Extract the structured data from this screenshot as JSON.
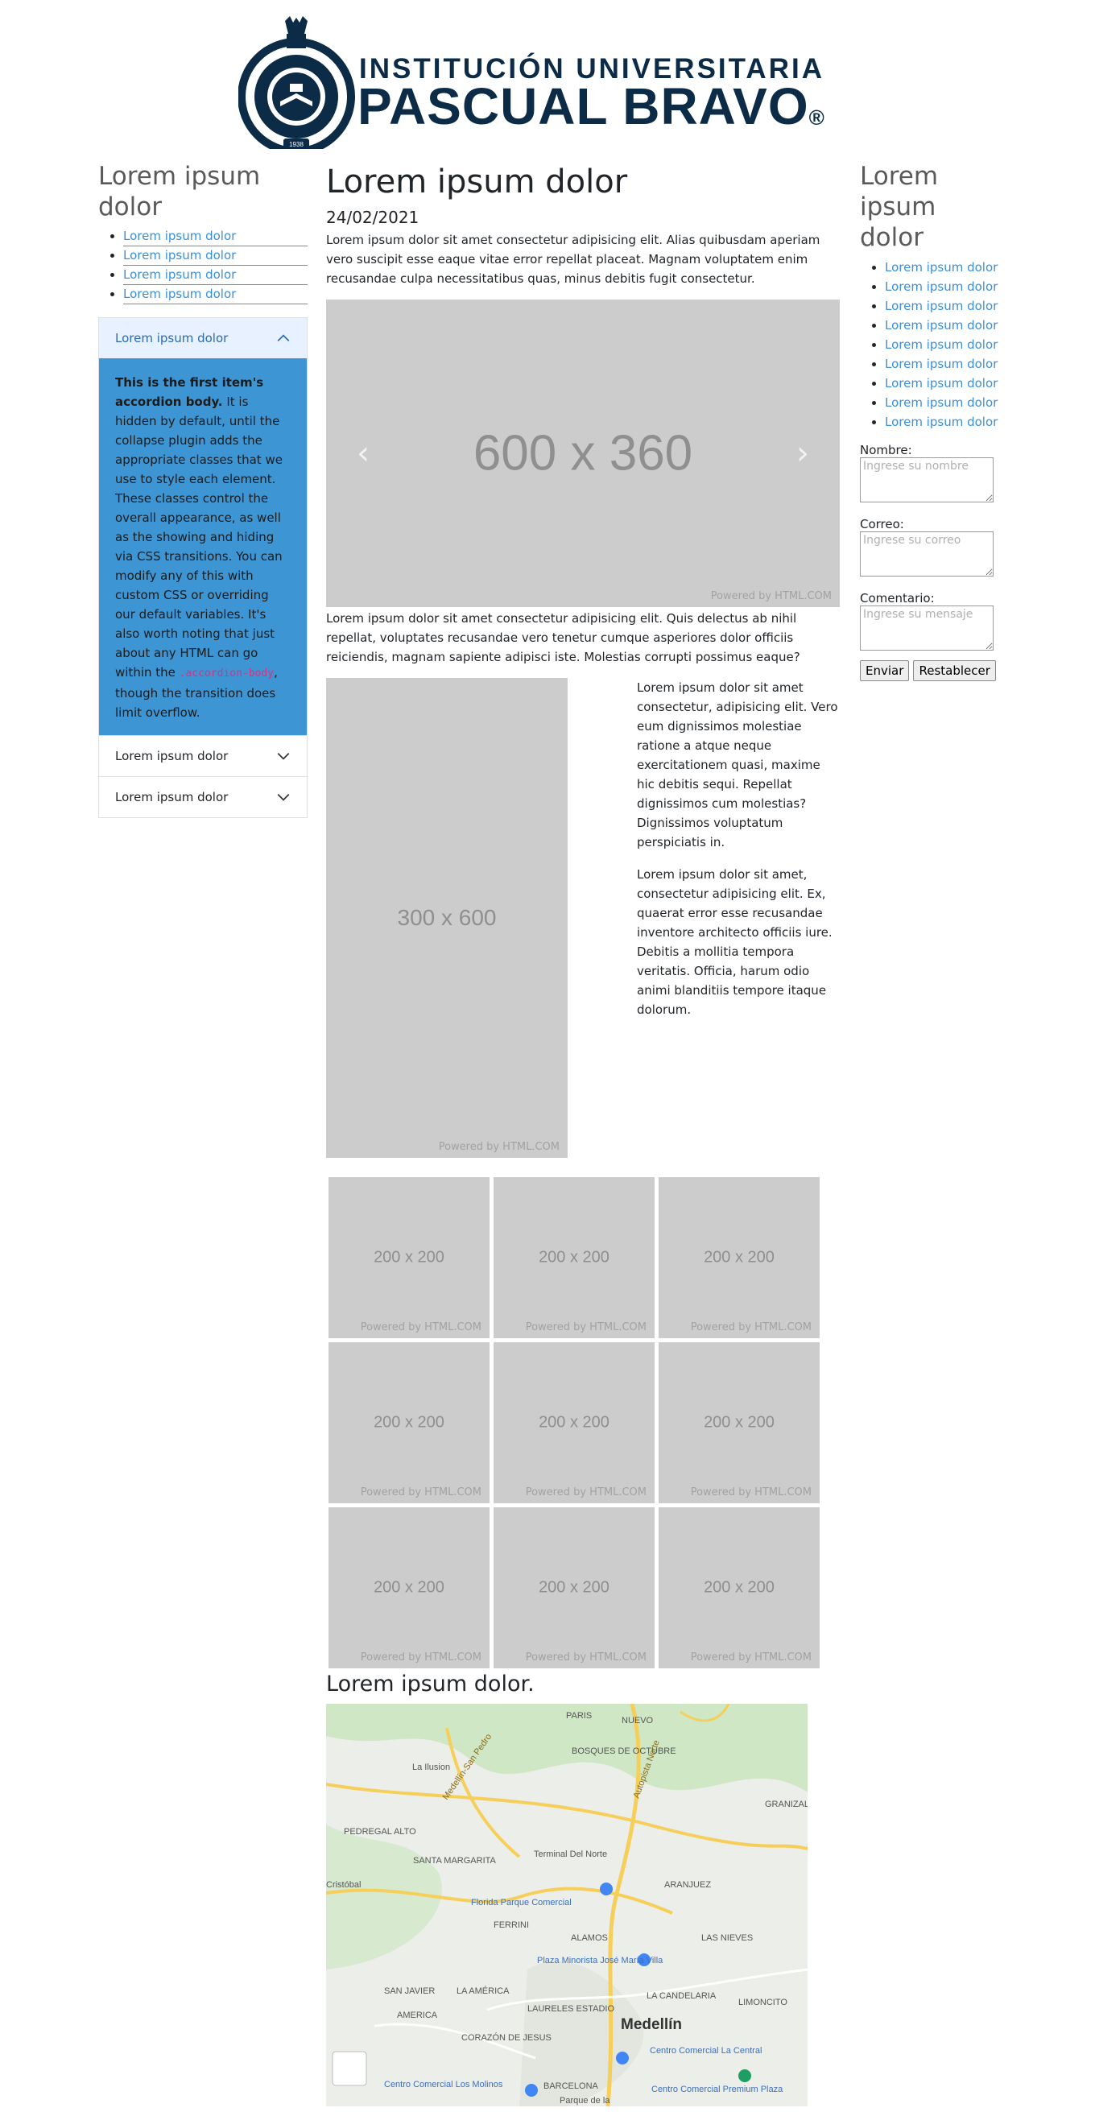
{
  "logo": {
    "line1": "INSTITUCIÓN UNIVERSITARIA",
    "line2": "PASCUAL BRAVO",
    "reg": "®",
    "year": "1938"
  },
  "left": {
    "title": "Lorem ipsum dolor",
    "links": [
      "Lorem ipsum dolor",
      "Lorem ipsum dolor",
      "Lorem ipsum dolor",
      "Lorem ipsum dolor"
    ],
    "accordion": [
      {
        "header": "Lorem ipsum dolor",
        "open": true
      },
      {
        "header": "Lorem ipsum dolor",
        "open": false
      },
      {
        "header": "Lorem ipsum dolor",
        "open": false
      }
    ],
    "accordion_body": {
      "bold": "This is the first item's accordion body.",
      "text1": " It is hidden by default, until the collapse plugin adds the appropriate classes that we use to style each element. These classes control the overall appearance, as well as the showing and hiding via CSS transitions. You can modify any of this with custom CSS or overriding our default variables. It's also worth noting that just about any HTML can go within the ",
      "code": ".accordion-body",
      "text2": ", though the transition does limit overflow."
    }
  },
  "center": {
    "title": "Lorem ipsum dolor",
    "date": "24/02/2021",
    "intro": "Lorem ipsum dolor sit amet consectetur adipisicing elit. Alias quibusdam aperiam vero suscipit esse eaque vitae error repellat placeat. Magnam voluptatem enim recusandae culpa necessitatibus quas, minus debitis fugit consectetur.",
    "carousel": {
      "label": "600 x 360",
      "powered": "Powered by HTML.COM",
      "prev": "‹",
      "next": "›"
    },
    "para2": "Lorem ipsum dolor sit amet consectetur adipisicing elit. Quis delectus ab nihil repellat, voluptates recusandae vero tenetur cumque asperiores dolor officiis reiciendis, magnam sapiente adipisci iste. Molestias corrupti possimus eaque?",
    "tall": {
      "label": "300 x 600",
      "powered": "Powered by HTML.COM"
    },
    "side_p1": "Lorem ipsum dolor sit amet consectetur, adipisicing elit. Vero eum dignissimos molestiae ratione a atque neque exercitationem quasi, maxime hic debitis sequi. Repellat dignissimos cum molestias? Dignissimos voluptatum perspiciatis in.",
    "side_p2": "Lorem ipsum dolor sit amet, consectetur adipisicing elit. Ex, quaerat error esse recusandae inventore architecto officiis iure. Debitis a mollitia tempora veritatis. Officia, harum odio animi blanditiis tempore itaque dolorum.",
    "grid": {
      "label": "200 x 200",
      "powered": "Powered by HTML.COM",
      "count": 9
    },
    "map_title": "Lorem ipsum dolor.",
    "map_labels": [
      "PARIS",
      "NUEVO",
      "La Ilusion",
      "BOSQUES DE OCTUBRE",
      "GRANIZAL",
      "PEDREGAL ALTO",
      "SANTA MARGARITA",
      "Terminal Del Norte",
      "ARANJUEZ",
      "Florida Parque Comercial",
      "FERRINI",
      "ALAMOS",
      "LAS NIEVES",
      "Plaza Minorista José María Villa",
      "SAN JAVIER",
      "LA AMÉRICA",
      "LA CANDELARIA",
      "LIMONCITO",
      "LAURELES ESTADIO",
      "Medellín",
      "CORAZÓN DE JESUS",
      "Centro Comercial La Central",
      "AMERICA",
      "Centro Comercial Los Molinos",
      "BARCELONA",
      "Centro Comercial Premium Plaza",
      "Parque de la",
      "Cristóbal",
      "Autopista Norte",
      "Medellín-San Pedro"
    ]
  },
  "right": {
    "title": "Lorem ipsum dolor",
    "links": [
      "Lorem ipsum dolor",
      "Lorem ipsum dolor",
      "Lorem ipsum dolor",
      "Lorem ipsum dolor",
      "Lorem ipsum dolor",
      "Lorem ipsum dolor",
      "Lorem ipsum dolor",
      "Lorem ipsum dolor",
      "Lorem ipsum dolor"
    ],
    "form": {
      "name_label": "Nombre:",
      "name_placeholder": "Ingrese su nombre",
      "email_label": "Correo:",
      "email_placeholder": "Ingrese su correo",
      "comment_label": "Comentario:",
      "comment_placeholder": "Ingrese su mensaje",
      "submit": "Enviar",
      "reset": "Restablecer"
    }
  },
  "colors": {
    "link": "#3b8fd9",
    "brand": "#0b2b47",
    "accordion_open": "#3d95d4",
    "placeholder_gray": "#cccccc"
  }
}
